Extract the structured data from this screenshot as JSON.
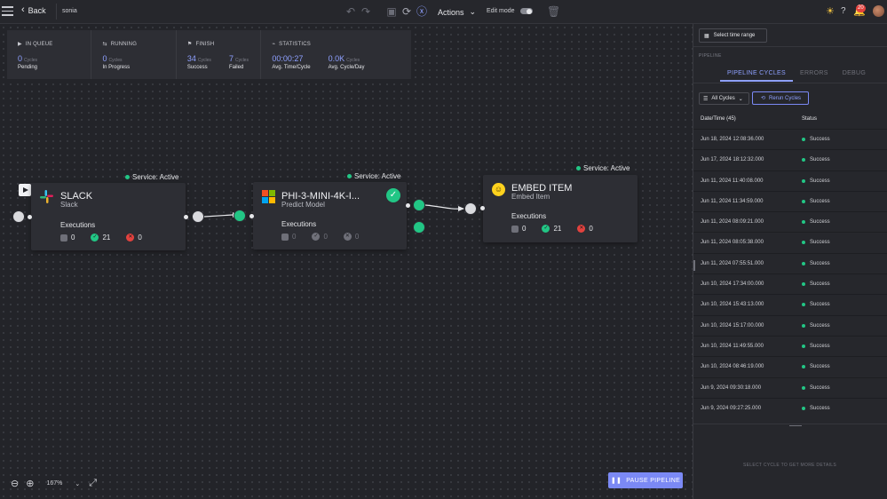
{
  "topbar": {
    "back_label": "Back",
    "project_name": "sonia",
    "actions_label": "Actions",
    "edit_mode_label": "Edit mode",
    "notifications_count": "20"
  },
  "stats": {
    "in_queue": {
      "title": "IN QUEUE",
      "value": "0",
      "unit": "Cycles",
      "label": "Pending"
    },
    "running": {
      "title": "RUNNING",
      "value": "0",
      "unit": "Cycles",
      "label": "In Progress"
    },
    "finish": {
      "title": "FINISH",
      "success_value": "34",
      "success_unit": "Cycles",
      "success_label": "Success",
      "failed_value": "7",
      "failed_unit": "Cycles",
      "failed_label": "Failed"
    },
    "statistics": {
      "title": "STATISTICS",
      "avg_time": "00:00:27",
      "avg_time_label": "Avg. Time/Cycle",
      "avg_cycle": "0.0K",
      "avg_cycle_unit": "Cycles",
      "avg_cycle_label": "Avg. Cycle/Day"
    }
  },
  "nodes": [
    {
      "title": "SLACK",
      "subtitle": "Slack",
      "service": "Service: Active",
      "executions_label": "Executions",
      "pending": "0",
      "success": "21",
      "errors": "0"
    },
    {
      "title": "PHI-3-MINI-4K-I...",
      "subtitle": "Predict Model",
      "service": "Service: Active",
      "executions_label": "Executions",
      "pending": "0",
      "success": "0",
      "errors": "0"
    },
    {
      "title": "EMBED ITEM",
      "subtitle": "Embed Item",
      "service": "Service: Active",
      "executions_label": "Executions",
      "pending": "0",
      "success": "21",
      "errors": "0"
    }
  ],
  "canvas": {
    "zoom_level": "167%",
    "pause_label": "PAUSE PIPELINE"
  },
  "panel": {
    "time_range_label": "Select time range",
    "section_label": "PIPELINE",
    "tabs": [
      "PIPELINE CYCLES",
      "ERRORS",
      "DEBUG"
    ],
    "filter_label": "All Cycles",
    "rerun_label": "Rerun Cycles",
    "col_datetime": "Date/Time (45)",
    "col_status": "Status",
    "rows": [
      {
        "datetime": "Jun 18, 2024 12:08:36.000",
        "status": "Success"
      },
      {
        "datetime": "Jun 17, 2024 18:12:32.000",
        "status": "Success"
      },
      {
        "datetime": "Jun 11, 2024 11:40:08.000",
        "status": "Success"
      },
      {
        "datetime": "Jun 11, 2024 11:34:59.000",
        "status": "Success"
      },
      {
        "datetime": "Jun 11, 2024 08:09:21.000",
        "status": "Success"
      },
      {
        "datetime": "Jun 11, 2024 08:05:38.000",
        "status": "Success"
      },
      {
        "datetime": "Jun 11, 2024 07:55:51.000",
        "status": "Success"
      },
      {
        "datetime": "Jun 10, 2024 17:34:00.000",
        "status": "Success"
      },
      {
        "datetime": "Jun 10, 2024 15:43:13.000",
        "status": "Success"
      },
      {
        "datetime": "Jun 10, 2024 15:17:00.000",
        "status": "Success"
      },
      {
        "datetime": "Jun 10, 2024 11:49:55.000",
        "status": "Success"
      },
      {
        "datetime": "Jun 10, 2024 08:46:19.000",
        "status": "Success"
      },
      {
        "datetime": "Jun 9, 2024 09:30:18.000",
        "status": "Success"
      },
      {
        "datetime": "Jun 9, 2024 09:27:25.000",
        "status": "Success"
      }
    ],
    "hint": "SELECT CYCLE TO GET MORE DETAILS"
  },
  "colors": {
    "accent": "#8ea0ff",
    "success": "#22c685",
    "error": "#e3423e",
    "button": "#7b89f5"
  }
}
